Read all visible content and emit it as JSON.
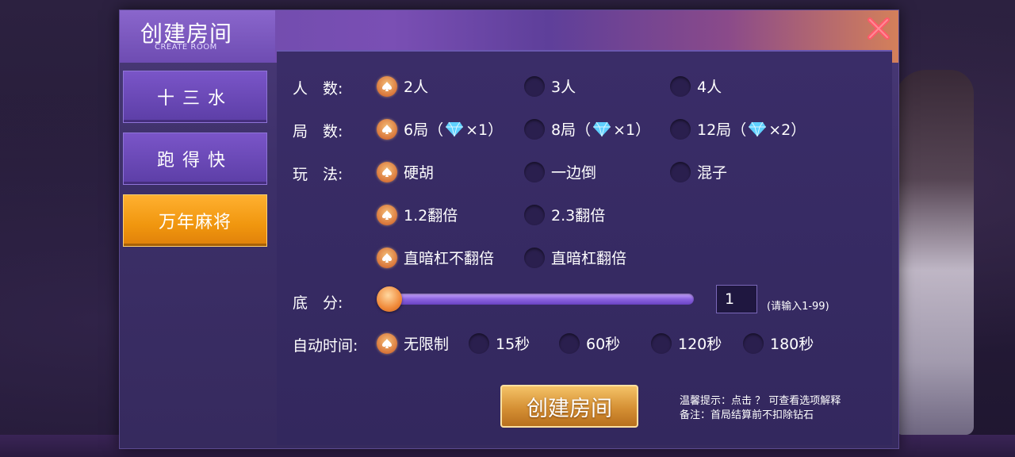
{
  "dialog": {
    "title": "创建房间",
    "subtitle": "CREATE ROOM",
    "close_icon": "close-icon"
  },
  "sidebar": {
    "items": [
      {
        "label": "十三水",
        "active": false
      },
      {
        "label": "跑得快",
        "active": false
      },
      {
        "label": "万年麻将",
        "active": true
      }
    ]
  },
  "players": {
    "label": "人　数:",
    "options": [
      {
        "text": "2人",
        "selected": true
      },
      {
        "text": "3人",
        "selected": false
      },
      {
        "text": "4人",
        "selected": false
      }
    ]
  },
  "rounds": {
    "label": "局　数:",
    "options": [
      {
        "text": "6局",
        "paren_open": "（",
        "cost": "×1）",
        "selected": true
      },
      {
        "text": "8局",
        "paren_open": "（",
        "cost": "×1）",
        "selected": false
      },
      {
        "text": "12局",
        "paren_open": "（",
        "cost": "×2）",
        "selected": false
      }
    ]
  },
  "rules": {
    "label": "玩　法:",
    "row1": [
      {
        "text": "硬胡",
        "selected": true
      },
      {
        "text": "一边倒",
        "selected": false
      },
      {
        "text": "混子",
        "selected": false
      }
    ],
    "row2": [
      {
        "text": "1.2翻倍",
        "selected": true
      },
      {
        "text": "2.3翻倍",
        "selected": false
      }
    ],
    "row3": [
      {
        "text": "直暗杠不翻倍",
        "selected": true
      },
      {
        "text": "直暗杠翻倍",
        "selected": false
      }
    ]
  },
  "base_score": {
    "label": "底　分:",
    "value": "1",
    "slider_fraction": 0.0,
    "hint": "(请输入1-99)"
  },
  "auto_time": {
    "label": "自动时间:",
    "options": [
      {
        "text": "无限制",
        "selected": true
      },
      {
        "text": "15秒",
        "selected": false
      },
      {
        "text": "60秒",
        "selected": false
      },
      {
        "text": "120秒",
        "selected": false
      },
      {
        "text": "180秒",
        "selected": false
      }
    ]
  },
  "footer": {
    "create_label": "创建房间",
    "tip_line1": "温馨提示：点击 ？ 可查看选项解释",
    "tip_line2": "备注：首局结算前不扣除钻石"
  },
  "colors": {
    "accent_orange": "#f0960e",
    "panel_purple": "#3a2d68",
    "radio_selected": "#d9763a"
  }
}
